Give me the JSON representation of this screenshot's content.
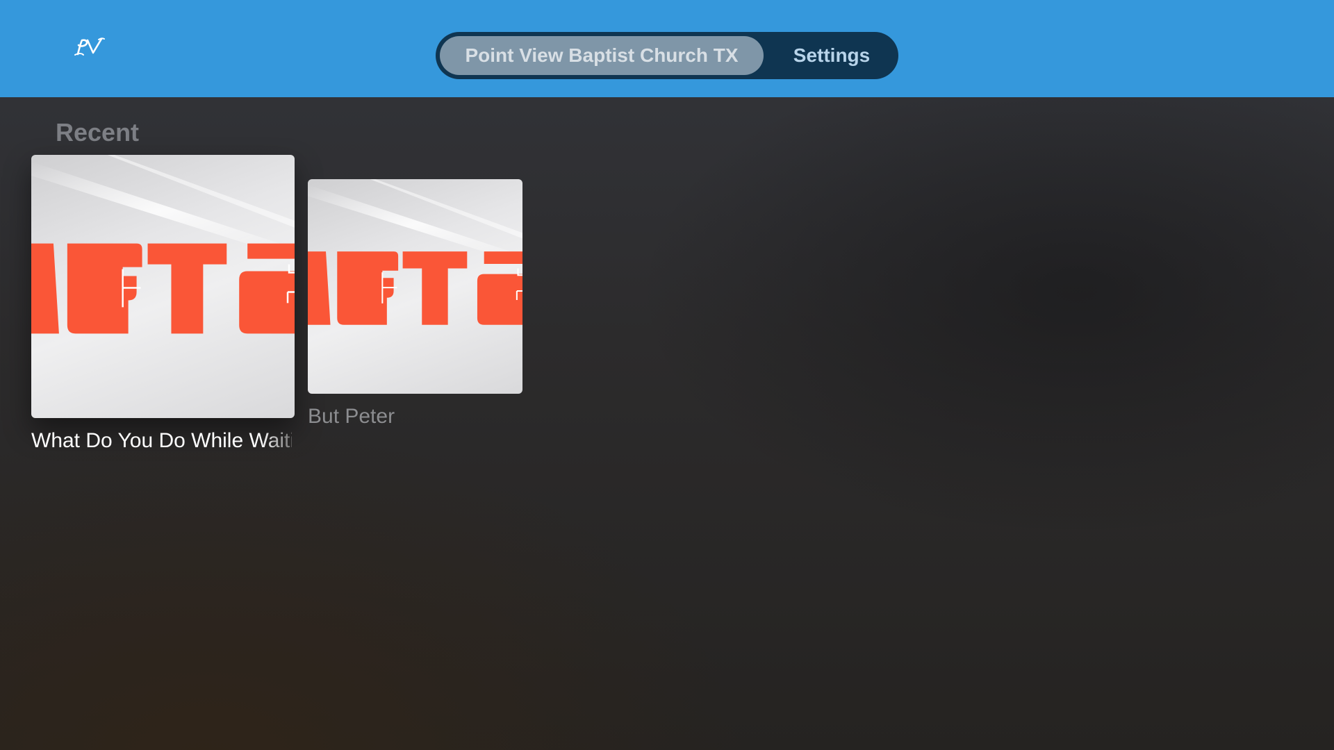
{
  "header": {
    "logo_icon": "pv-logo-icon",
    "bar_color": "#3598dc",
    "tabs": [
      {
        "label": "Point View Baptist Church TX",
        "selected": true
      },
      {
        "label": "Settings",
        "selected": false
      }
    ]
  },
  "main": {
    "section_title": "Recent",
    "items": [
      {
        "title": "What Do You Do While Waiting",
        "art_text": "ACTS",
        "focused": true
      },
      {
        "title": "But Peter",
        "art_text": "ACTS",
        "focused": false
      }
    ],
    "art_accent_color": "#fa5637"
  }
}
